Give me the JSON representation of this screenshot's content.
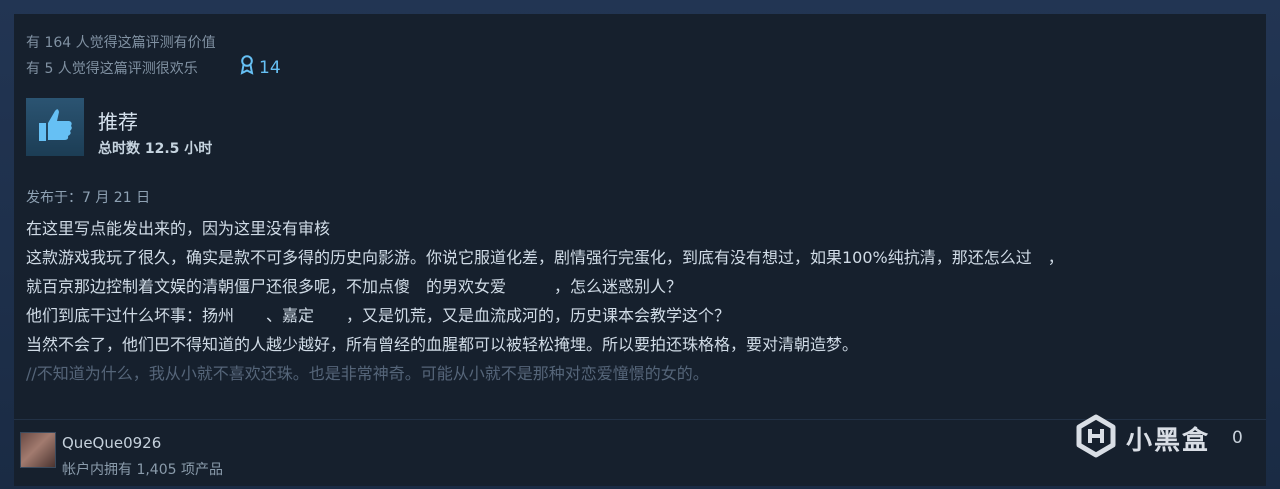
{
  "review": {
    "helpful_text": "有 164 人觉得这篇评测有价值",
    "funny_text": "有 5 人觉得这篇评测很欢乐",
    "award_count": "14",
    "verdict": "推荐",
    "hours": "总时数 12.5 小时",
    "posted": "发布于：7 月 21 日",
    "lines": [
      "在这里写点能发出来的，因为这里没有审核",
      "这款游戏我玩了很久，确实是款不可多得的历史向影游。你说它服道化差，剧情强行完蛋化，到底有没有想过，如果100%纯抗清，那还怎么过　，",
      "就百京那边控制着文娱的清朝僵尸还很多呢，不加点傻　的男欢女爱　　　，怎么迷惑别人？",
      "他们到底干过什么坏事：扬州　　、嘉定　　，又是饥荒，又是血流成河的，历史课本会教学这个？",
      "当然不会了，他们巴不得知道的人越少越好，所有曾经的血腥都可以被轻松掩埋。所以要拍还珠格格，要对清朝造梦。",
      "//不知道为什么，我从小就不喜欢还珠。也是非常神奇。可能从小就不是那种对恋爱憧憬的女的。"
    ]
  },
  "author": {
    "name": "QueQue0926",
    "products": "帐户内拥有 1,405 项产品"
  },
  "watermark": {
    "text": "小黑盒"
  },
  "footer_count": "0"
}
